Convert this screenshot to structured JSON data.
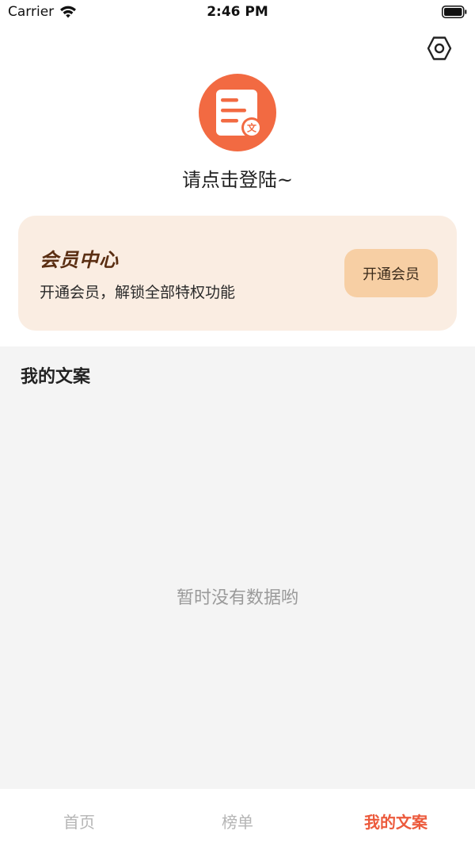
{
  "status_bar": {
    "carrier": "Carrier",
    "time": "2:46 PM"
  },
  "icons": {
    "settings": "hexagon-gear-icon",
    "avatar": "document-icon",
    "wifi": "wifi-icon",
    "battery": "battery-icon"
  },
  "profile": {
    "login_prompt": "请点击登陆~",
    "avatar_badge": "文"
  },
  "member_card": {
    "title": "会员中心",
    "description": "开通会员，解锁全部特权功能",
    "button_label": "开通会员"
  },
  "my_copy": {
    "title": "我的文案",
    "empty_text": "暂时没有数据哟"
  },
  "tab_bar": {
    "tabs": [
      {
        "label": "首页",
        "active": false
      },
      {
        "label": "榜单",
        "active": false
      },
      {
        "label": "我的文案",
        "active": true
      }
    ]
  },
  "colors": {
    "accent": "#ec5a3c",
    "avatar_bg": "#f26a42",
    "card_bg": "#faede2",
    "button_bg": "#f7cfa4",
    "section_bg": "#f4f4f4"
  }
}
